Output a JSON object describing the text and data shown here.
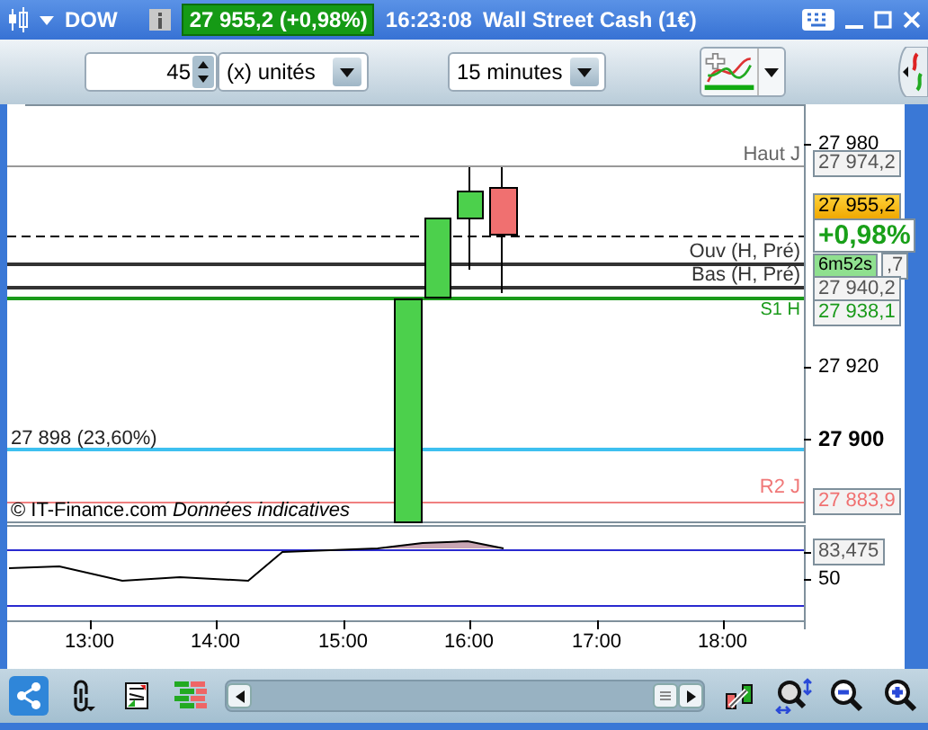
{
  "title_bar": {
    "instrument": "DOW",
    "price_badge": "27 955,2 (+0,98%)",
    "time": "16:23:08",
    "name": "Wall Street Cash (1€)"
  },
  "toolbar": {
    "quantity": "45",
    "unit_select": "(x) unités",
    "period_select": "15 minutes"
  },
  "chart": {
    "line_labels": [
      {
        "text": "Haut J",
        "kind": "grey"
      },
      {
        "text": "Ouv (H, Pré)",
        "kind": "dark"
      },
      {
        "text": "Bas (H, Pré)",
        "kind": "dark"
      },
      {
        "text": "S1 H",
        "kind": "green"
      },
      {
        "text": "27 898 (23,60%)",
        "kind": "left"
      },
      {
        "text": "R2 J",
        "kind": "red"
      }
    ],
    "credit": "© IT-Finance.com *Données indicatives*",
    "axis_labels": [
      {
        "text": "27 980",
        "kind": "tick"
      },
      {
        "text": "27 974,2",
        "kind": "box"
      },
      {
        "text": "27 955,2",
        "kind": "current"
      },
      {
        "text": "+0,98%",
        "kind": "change"
      },
      {
        "text": "6m52s",
        "kind": "timer"
      },
      {
        "text": ",7",
        "kind": "box"
      },
      {
        "text": "27 940,2",
        "kind": "box"
      },
      {
        "text": "27 938,1",
        "kind": "green"
      },
      {
        "text": "27 920",
        "kind": "tick"
      },
      {
        "text": "27 900",
        "kind": "bold"
      },
      {
        "text": "27 883,9",
        "kind": "red"
      }
    ],
    "indicator_labels": [
      {
        "text": "83,475",
        "kind": "box"
      },
      {
        "text": "50",
        "kind": "tick"
      }
    ],
    "time_labels": [
      "13:00",
      "14:00",
      "15:00",
      "16:00",
      "17:00",
      "18:00"
    ]
  },
  "bottom_toolbar": {
    "share_selected": true
  }
}
